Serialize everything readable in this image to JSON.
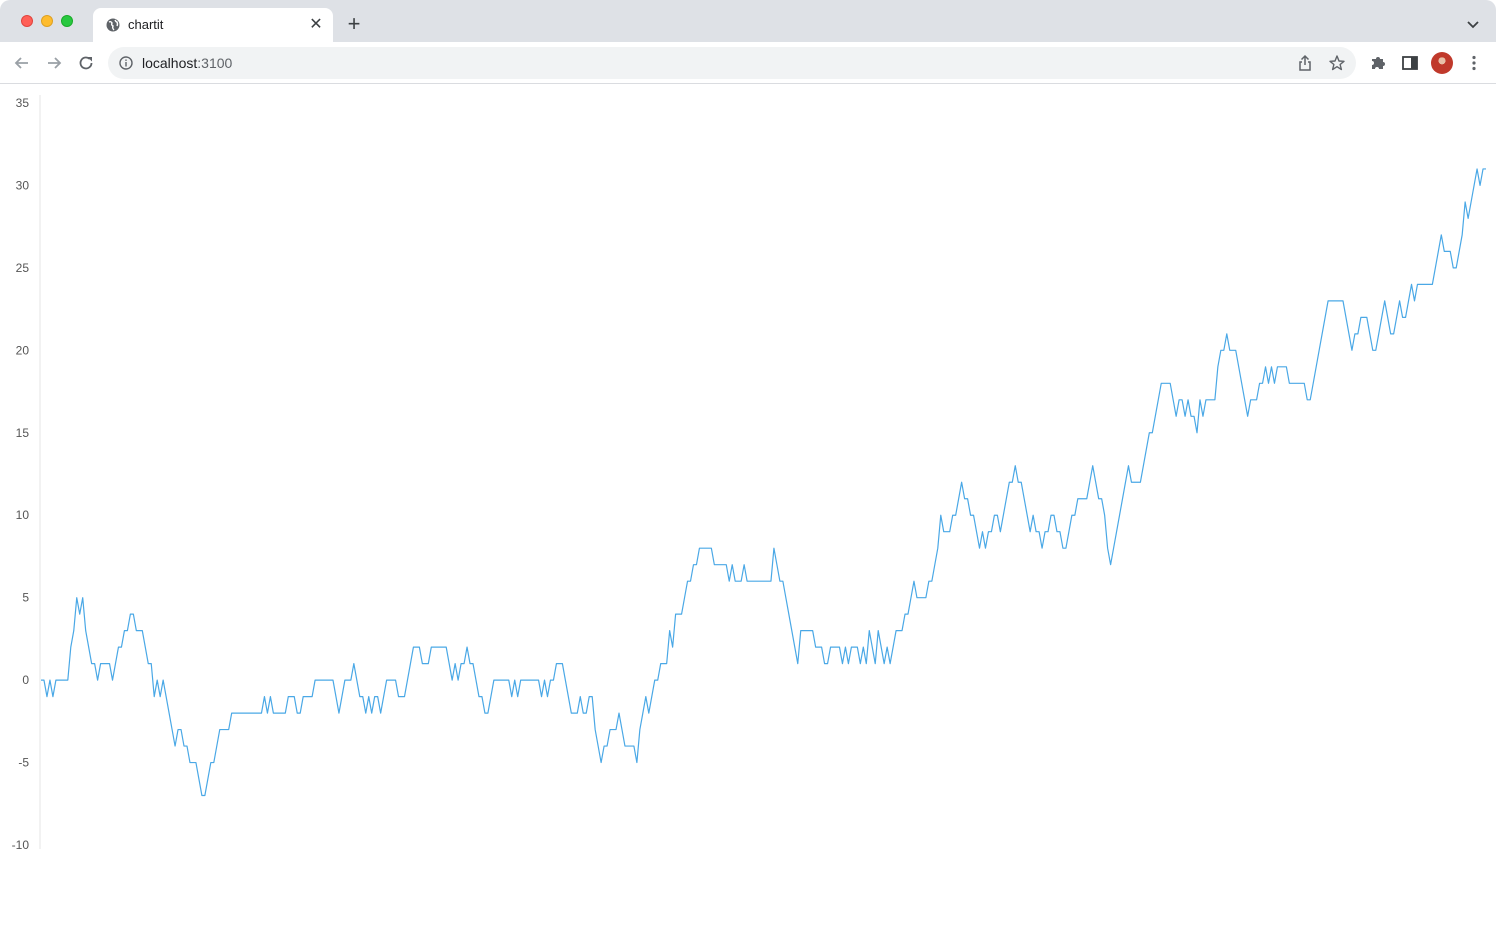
{
  "browser": {
    "tab_title": "chartit",
    "tab_close_glyph": "✕",
    "new_tab_glyph": "+",
    "url_host": "localhost",
    "url_port": ":3100",
    "icons": [
      "globe-icon",
      "close-icon",
      "plus-icon",
      "chevron-down-icon",
      "back-arrow-icon",
      "forward-arrow-icon",
      "reload-icon",
      "info-icon",
      "share-icon",
      "star-icon",
      "puzzle-icon",
      "side-panel-icon",
      "avatar",
      "kebab-menu-icon"
    ]
  },
  "chart_data": {
    "type": "line",
    "title": "",
    "xlabel": "",
    "ylabel": "",
    "ylim": [
      -10,
      35
    ],
    "yticks": [
      35,
      30,
      25,
      20,
      15,
      10,
      5,
      0,
      -5,
      -10
    ],
    "grid": false,
    "line_color": "#4aa8e6",
    "series": [
      {
        "values": [
          0,
          0,
          -1,
          0,
          -1,
          0,
          0,
          0,
          0,
          0,
          2,
          3,
          5,
          4,
          5,
          3,
          2,
          1,
          1,
          0,
          1,
          1,
          1,
          1,
          0,
          1,
          2,
          2,
          3,
          3,
          4,
          4,
          3,
          3,
          3,
          2,
          1,
          1,
          -1,
          0,
          -1,
          0,
          -1,
          -2,
          -3,
          -4,
          -3,
          -3,
          -4,
          -4,
          -5,
          -5,
          -5,
          -6,
          -7,
          -7,
          -6,
          -5,
          -5,
          -4,
          -3,
          -3,
          -3,
          -3,
          -2,
          -2,
          -2,
          -2,
          -2,
          -2,
          -2,
          -2,
          -2,
          -2,
          -2,
          -1,
          -2,
          -1,
          -2,
          -2,
          -2,
          -2,
          -2,
          -1,
          -1,
          -1,
          -2,
          -2,
          -1,
          -1,
          -1,
          -1,
          0,
          0,
          0,
          0,
          0,
          0,
          0,
          -1,
          -2,
          -1,
          0,
          0,
          0,
          1,
          0,
          -1,
          -1,
          -2,
          -1,
          -2,
          -1,
          -1,
          -2,
          -1,
          0,
          0,
          0,
          0,
          -1,
          -1,
          -1,
          0,
          1,
          2,
          2,
          2,
          1,
          1,
          1,
          2,
          2,
          2,
          2,
          2,
          2,
          1,
          0,
          1,
          0,
          1,
          1,
          2,
          1,
          1,
          0,
          -1,
          -1,
          -2,
          -2,
          -1,
          0,
          0,
          0,
          0,
          0,
          0,
          -1,
          0,
          -1,
          0,
          0,
          0,
          0,
          0,
          0,
          0,
          -1,
          0,
          -1,
          0,
          0,
          1,
          1,
          1,
          0,
          -1,
          -2,
          -2,
          -2,
          -1,
          -2,
          -2,
          -1,
          -1,
          -3,
          -4,
          -5,
          -4,
          -4,
          -3,
          -3,
          -3,
          -2,
          -3,
          -4,
          -4,
          -4,
          -4,
          -5,
          -3,
          -2,
          -1,
          -2,
          -1,
          0,
          0,
          1,
          1,
          1,
          3,
          2,
          4,
          4,
          4,
          5,
          6,
          6,
          7,
          7,
          8,
          8,
          8,
          8,
          8,
          7,
          7,
          7,
          7,
          7,
          6,
          7,
          6,
          6,
          6,
          7,
          6,
          6,
          6,
          6,
          6,
          6,
          6,
          6,
          6,
          8,
          7,
          6,
          6,
          5,
          4,
          3,
          2,
          1,
          3,
          3,
          3,
          3,
          3,
          2,
          2,
          2,
          1,
          1,
          2,
          2,
          2,
          2,
          1,
          2,
          1,
          2,
          2,
          2,
          1,
          2,
          1,
          3,
          2,
          1,
          3,
          2,
          1,
          2,
          1,
          2,
          3,
          3,
          3,
          4,
          4,
          5,
          6,
          5,
          5,
          5,
          5,
          6,
          6,
          7,
          8,
          10,
          9,
          9,
          9,
          10,
          10,
          11,
          12,
          11,
          11,
          10,
          10,
          9,
          8,
          9,
          8,
          9,
          9,
          10,
          10,
          9,
          10,
          11,
          12,
          12,
          13,
          12,
          12,
          11,
          10,
          9,
          10,
          9,
          9,
          8,
          9,
          9,
          10,
          10,
          9,
          9,
          8,
          8,
          9,
          10,
          10,
          11,
          11,
          11,
          11,
          12,
          13,
          12,
          11,
          11,
          10,
          8,
          7,
          8,
          9,
          10,
          11,
          12,
          13,
          12,
          12,
          12,
          12,
          13,
          14,
          15,
          15,
          16,
          17,
          18,
          18,
          18,
          18,
          17,
          16,
          17,
          17,
          16,
          17,
          16,
          16,
          15,
          17,
          16,
          17,
          17,
          17,
          17,
          19,
          20,
          20,
          21,
          20,
          20,
          20,
          19,
          18,
          17,
          16,
          17,
          17,
          17,
          18,
          18,
          19,
          18,
          19,
          18,
          19,
          19,
          19,
          19,
          18,
          18,
          18,
          18,
          18,
          18,
          17,
          17,
          18,
          19,
          20,
          21,
          22,
          23,
          23,
          23,
          23,
          23,
          23,
          22,
          21,
          20,
          21,
          21,
          22,
          22,
          22,
          21,
          20,
          20,
          21,
          22,
          23,
          22,
          21,
          21,
          22,
          23,
          22,
          22,
          23,
          24,
          23,
          24,
          24,
          24,
          24,
          24,
          24,
          25,
          26,
          27,
          26,
          26,
          26,
          25,
          25,
          26,
          27,
          29,
          28,
          29,
          30,
          31,
          30,
          31,
          31
        ]
      }
    ]
  }
}
